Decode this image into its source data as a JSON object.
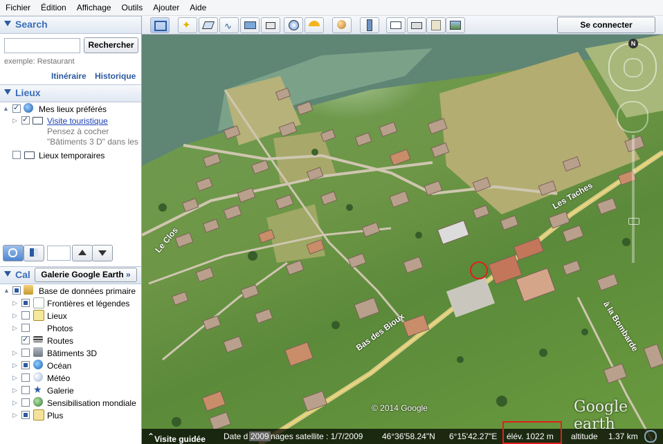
{
  "menu": [
    "Fichier",
    "Édition",
    "Affichage",
    "Outils",
    "Ajouter",
    "Aide"
  ],
  "search": {
    "title": "Search",
    "button": "Rechercher",
    "hint": "exemple: Restaurant",
    "links": [
      "Itinéraire",
      "Historique"
    ]
  },
  "places": {
    "title": "Lieux",
    "items": [
      {
        "label": "Mes lieux préférés"
      },
      {
        "label": "Visite touristique"
      },
      {
        "label": "Pensez à cocher"
      },
      {
        "label": "\"Bâtiments 3 D\" dans les"
      },
      {
        "label": "Lieux temporaires"
      }
    ]
  },
  "layers": {
    "title": "Cal",
    "gallery_button": "Galerie Google Earth",
    "gallery_arrow": "»",
    "items": [
      {
        "label": "Base de données primaire"
      },
      {
        "label": "Frontières et légendes"
      },
      {
        "label": "Lieux"
      },
      {
        "label": "Photos"
      },
      {
        "label": "Routes"
      },
      {
        "label": "Bâtiments 3D"
      },
      {
        "label": "Océan"
      },
      {
        "label": "Météo"
      },
      {
        "label": "Galerie"
      },
      {
        "label": "Sensibilisation mondiale"
      },
      {
        "label": "Plus"
      }
    ]
  },
  "toolbar": {
    "signin": "Se connecter"
  },
  "map": {
    "roads": [
      "Bas des Bioux",
      "Les Taches",
      "Le Clos",
      "à la Bombarde"
    ],
    "compass_n": "N",
    "copyright": "© 2014 Google",
    "logo": "Google earth"
  },
  "status": {
    "tour": "Visite guidée",
    "date": "Date d",
    "year": "2009",
    "imagery": "nages satellite : 1/7/2009",
    "lat": "46°36'58.24\"N",
    "lon": "6°15'42.27\"E",
    "elev": "élév. 1022 m",
    "alt": "altitude",
    "altval": "1.37 km"
  },
  "colors": {
    "accent": "#2c5aa0",
    "highlight": "#e0201c"
  }
}
